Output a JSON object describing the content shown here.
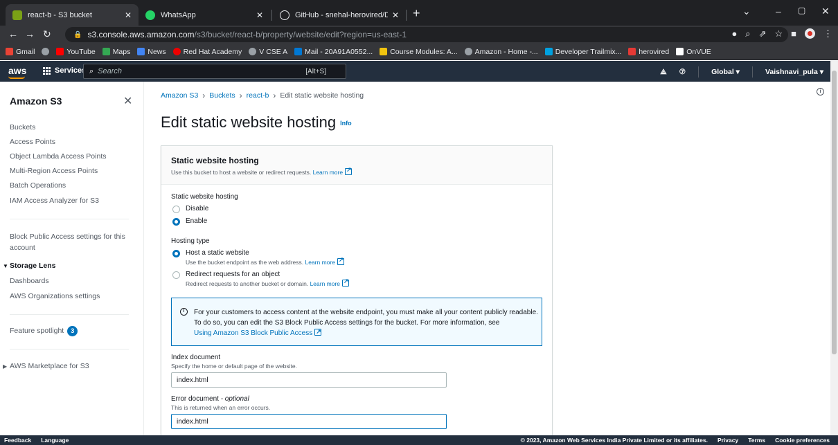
{
  "browser": {
    "tabs": [
      {
        "label": "react-b - S3 bucket",
        "favicon_color": "#7aa116"
      },
      {
        "label": "WhatsApp",
        "favicon_color": "#25d366"
      },
      {
        "label": "GitHub - snehal-herovired/Devo",
        "favicon_color": "#ffffff"
      }
    ],
    "new_tab": "+",
    "url_host": "s3.console.aws.amazon.com",
    "url_path": "/s3/bucket/react-b/property/website/edit?region=us-east-1",
    "bookmarks": [
      {
        "label": "Gmail",
        "color": "#ea4335"
      },
      {
        "label": "",
        "color": "#9aa0a6"
      },
      {
        "label": "YouTube",
        "color": "#ff0000"
      },
      {
        "label": "Maps",
        "color": "#34a853"
      },
      {
        "label": "News",
        "color": "#4285f4"
      },
      {
        "label": "Red Hat Academy",
        "color": "#ee0000"
      },
      {
        "label": "V CSE A",
        "color": "#9aa0a6"
      },
      {
        "label": "Mail - 20A91A0552...",
        "color": "#0078d4"
      },
      {
        "label": "Course Modules: A...",
        "color": "#f1c40f"
      },
      {
        "label": "Amazon - Home -...",
        "color": "#9aa0a6"
      },
      {
        "label": "Developer Trailmix...",
        "color": "#00a1e0"
      },
      {
        "label": "herovired",
        "color": "#e53935"
      },
      {
        "label": "OnVUE",
        "color": "#ffffff"
      }
    ]
  },
  "aws_nav": {
    "logo": "aws",
    "services": "Services",
    "search_placeholder": "Search",
    "search_shortcut": "[Alt+S]",
    "region": "Global ▾",
    "user": "Vaishnavi_pula ▾"
  },
  "sidebar": {
    "title": "Amazon S3",
    "items": [
      "Buckets",
      "Access Points",
      "Object Lambda Access Points",
      "Multi-Region Access Points",
      "Batch Operations",
      "IAM Access Analyzer for S3"
    ],
    "block_public": "Block Public Access settings for this account",
    "storage_lens": "Storage Lens",
    "storage_lens_items": [
      "Dashboards",
      "AWS Organizations settings"
    ],
    "feature_spotlight": "Feature spotlight",
    "feature_count": "3",
    "marketplace": "AWS Marketplace for S3"
  },
  "breadcrumb": {
    "items": [
      "Amazon S3",
      "Buckets",
      "react-b"
    ],
    "current": "Edit static website hosting"
  },
  "page": {
    "title": "Edit static website hosting",
    "info": "Info"
  },
  "panel": {
    "title": "Static website hosting",
    "desc": "Use this bucket to host a website or redirect requests.",
    "learn_more": "Learn more",
    "hosting_label": "Static website hosting",
    "disable": "Disable",
    "enable": "Enable",
    "hosting_type_label": "Hosting type",
    "host_static": "Host a static website",
    "host_static_desc": "Use the bucket endpoint as the web address.",
    "redirect": "Redirect requests for an object",
    "redirect_desc": "Redirect requests to another bucket or domain.",
    "alert_text": "For your customers to access content at the website endpoint, you must make all your content publicly readable. To do so, you can edit the S3 Block Public Access settings for the bucket. For more information, see",
    "alert_link": "Using Amazon S3 Block Public Access",
    "index_label": "Index document",
    "index_help": "Specify the home or default page of the website.",
    "index_value": "index.html",
    "error_label": "Error document",
    "error_optional": "- optional",
    "error_help": "This is returned when an error occurs.",
    "error_value": "index.html"
  },
  "footer": {
    "feedback": "Feedback",
    "language": "Language",
    "copyright": "© 2023, Amazon Web Services India Private Limited or its affiliates.",
    "privacy": "Privacy",
    "terms": "Terms",
    "cookies": "Cookie preferences"
  }
}
